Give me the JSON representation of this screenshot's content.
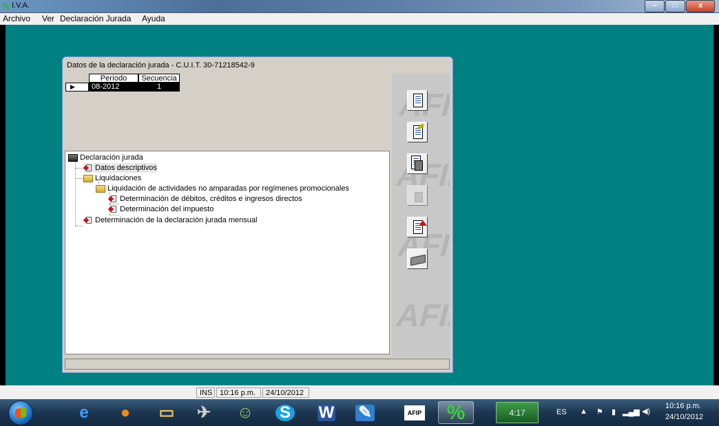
{
  "window": {
    "title": "I.V.A.",
    "minimize_glyph": "–",
    "maximize_glyph": "□",
    "close_glyph": "x"
  },
  "menu": [
    {
      "label": "Archivo"
    },
    {
      "label": "Ver"
    },
    {
      "label": "Declaración Jurada"
    },
    {
      "label": "Ayuda"
    }
  ],
  "dialog": {
    "title": "Datos de la declaración jurada - C.U.I.T. 30-71218542-9",
    "grid": {
      "columns": [
        "Período",
        "Secuencia"
      ],
      "rows": [
        {
          "periodo": "08-2012",
          "secuencia": "1"
        }
      ],
      "row_marker": "▶"
    },
    "tree": [
      {
        "label": "Declaración jurada",
        "icon": "computer-icon"
      },
      {
        "label": "Datos descriptivos",
        "icon": "document-icon"
      },
      {
        "label": "Liquidaciones",
        "icon": "folder-icon"
      },
      {
        "label": "Liquidación de actividades no amparadas por regímenes promocionales",
        "icon": "folder-icon"
      },
      {
        "label": "Determinación de débitos, créditos e ingresos directos",
        "icon": "document-icon"
      },
      {
        "label": "Determinación del impuesto",
        "icon": "document-icon"
      },
      {
        "label": "Determinación de la declaración jurada mensual",
        "icon": "document-icon"
      }
    ],
    "toolbar_icons": [
      "document-icon",
      "edit-document-icon",
      "delete-icon",
      "delete-disabled-icon",
      "export-icon",
      "print-icon"
    ],
    "watermark": "AFIP"
  },
  "status": {
    "mode": "INS",
    "time": "10:16 p.m.",
    "date": "24/10/2012"
  },
  "taskbar": {
    "timer": "4:17",
    "language": "ES",
    "clock_time": "10:16 p.m.",
    "clock_date": "24/10/2012",
    "pinned": [
      "ie-icon",
      "firefox-icon",
      "explorer-icon",
      "app-icon",
      "people-icon",
      "skype-icon",
      "word-icon",
      "pen-icon",
      "afip-icon",
      "percent-icon"
    ]
  },
  "colors": {
    "desktop": "#008080",
    "dialog": "#d4d0c8",
    "selection": "#000000",
    "doc_icon_red": "#c4161c"
  }
}
